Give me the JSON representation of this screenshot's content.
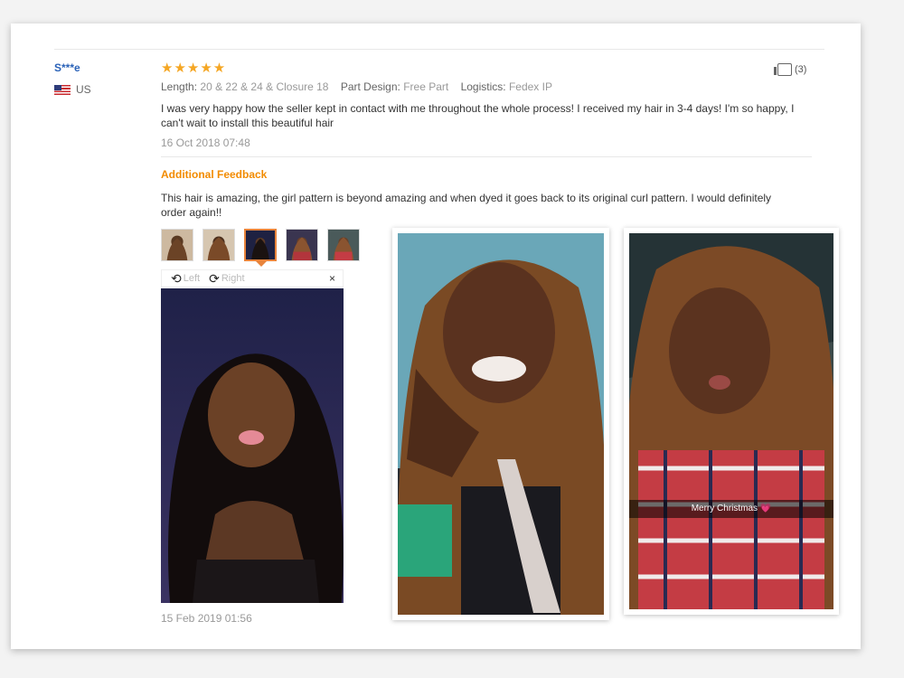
{
  "review": {
    "username": "S***e",
    "country": "US",
    "rating_stars": "★★★★★",
    "likes": "(3)",
    "attributes": [
      {
        "label": "Length:",
        "value": "20 & 22 & 24 & Closure 18"
      },
      {
        "label": "Part Design:",
        "value": "Free Part"
      },
      {
        "label": "Logistics:",
        "value": "Fedex IP"
      }
    ],
    "text": "I was very happy how the seller kept in contact with me throughout the whole process! I received my hair in 3-4 days! I'm so happy, I can't wait to install this beautiful hair",
    "date": "16 Oct 2018 07:48"
  },
  "additional": {
    "title": "Additional Feedback",
    "text": "This hair is amazing, the girl pattern is beyond amazing and when dyed it goes back to its original curl pattern. I would definitely order again!!",
    "date": "15 Feb 2019 01:56"
  },
  "viewer": {
    "left_label": "Left",
    "right_label": "Right",
    "close": "×"
  },
  "photo_caption": "Merry Christmas 💗",
  "colors": {
    "accent": "#f28b00",
    "star": "#f5a623",
    "user_link": "#2a62b8"
  }
}
